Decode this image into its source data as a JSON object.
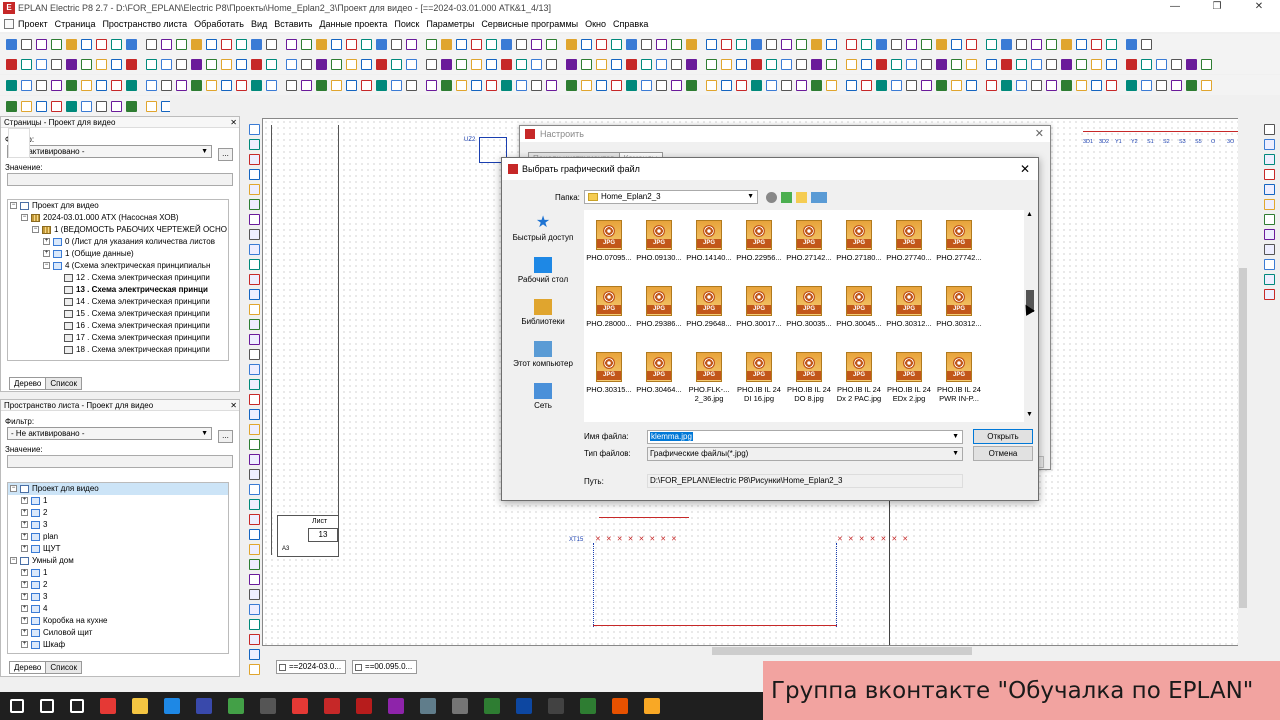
{
  "window": {
    "title": "EPLAN Electric P8 2.7 - D:\\FOR_EPLAN\\Electric P8\\Проекты\\Home_Eplan2_3\\Проект для видео - [==2024-03.01.000 АТК&1_4/13]",
    "app_icon": "eplan-icon"
  },
  "menu": [
    "Проект",
    "Страница",
    "Пространство листа",
    "Обработать",
    "Вид",
    "Вставить",
    "Данные проекта",
    "Поиск",
    "Параметры",
    "Сервисные программы",
    "Окно",
    "Справка"
  ],
  "toolbar_row1_extra": "9  ∅",
  "pages_pane": {
    "title": "Страницы - Проект для видео",
    "filter_label": "Фильтр:",
    "filter_value": "- Не активировано -",
    "value_label": "Значение:",
    "dots": "...",
    "tree": [
      {
        "text": "Проект для видео",
        "level": 0,
        "pm": "−",
        "icon": "doc"
      },
      {
        "text": "2024-03.01.000 АТХ (Насосная ХОВ)",
        "level": 1,
        "pm": "−",
        "icon": "grid"
      },
      {
        "text": "1 (ВЕДОМОСТЬ РАБОЧИХ ЧЕРТЕЖЕЙ ОСНО",
        "level": 2,
        "pm": "−",
        "icon": "grid"
      },
      {
        "text": "0 (Лист для указания количества листов",
        "level": 3,
        "pm": "+",
        "icon": "page"
      },
      {
        "text": "1 (Общие данные)",
        "level": 3,
        "pm": "+",
        "icon": "page"
      },
      {
        "text": "4 (Схема электрическая  принципиальн",
        "level": 3,
        "pm": "−",
        "icon": "page"
      },
      {
        "text": "12 . Схема электрическая принципи",
        "level": 4,
        "pm": "",
        "icon": "sheet"
      },
      {
        "text": "13 . Схема электрическая принци",
        "level": 4,
        "pm": "",
        "icon": "sheet",
        "bold": true
      },
      {
        "text": "14 . Схема электрическая принципи",
        "level": 4,
        "pm": "",
        "icon": "sheet"
      },
      {
        "text": "15 . Схема электрическая принципи",
        "level": 4,
        "pm": "",
        "icon": "sheet"
      },
      {
        "text": "16 . Схема электрическая принципи",
        "level": 4,
        "pm": "",
        "icon": "sheet"
      },
      {
        "text": "17 . Схема электрическая принципи",
        "level": 4,
        "pm": "",
        "icon": "sheet"
      },
      {
        "text": "18 . Схема электрическая принципи",
        "level": 4,
        "pm": "",
        "icon": "sheet"
      }
    ],
    "tabs": [
      "Дерево",
      "Список"
    ]
  },
  "layout_pane": {
    "title": "Пространство листа - Проект для видео",
    "filter_label": "Фильтр:",
    "filter_value": "- Не активировано -",
    "value_label": "Значение:",
    "dots": "...",
    "tree": [
      {
        "text": "Проект для видео",
        "level": 0,
        "pm": "−",
        "icon": "doc",
        "selected": true
      },
      {
        "text": "1",
        "level": 1,
        "pm": "+",
        "icon": "page"
      },
      {
        "text": "2",
        "level": 1,
        "pm": "+",
        "icon": "page"
      },
      {
        "text": "3",
        "level": 1,
        "pm": "+",
        "icon": "page"
      },
      {
        "text": "plan",
        "level": 1,
        "pm": "+",
        "icon": "page"
      },
      {
        "text": "ЩУТ",
        "level": 1,
        "pm": "+",
        "icon": "page"
      },
      {
        "text": "Умный дом",
        "level": 0,
        "pm": "−",
        "icon": "doc"
      },
      {
        "text": "1",
        "level": 1,
        "pm": "+",
        "icon": "page"
      },
      {
        "text": "2",
        "level": 1,
        "pm": "+",
        "icon": "page"
      },
      {
        "text": "3",
        "level": 1,
        "pm": "+",
        "icon": "page"
      },
      {
        "text": "4",
        "level": 1,
        "pm": "+",
        "icon": "page"
      },
      {
        "text": "Коробка на кухне",
        "level": 1,
        "pm": "+",
        "icon": "page"
      },
      {
        "text": "Силовой щит",
        "level": 1,
        "pm": "+",
        "icon": "page"
      },
      {
        "text": "Шкаф",
        "level": 1,
        "pm": "+",
        "icon": "page"
      }
    ],
    "tabs": [
      "Дерево",
      "Список"
    ]
  },
  "canvas": {
    "label_uz2": "UZ2",
    "label_xt15": "XT15",
    "sheet_label": "Лист",
    "sheet_num": "13",
    "format": "А3",
    "header_labels": [
      "3D1",
      "3D2",
      "Y1",
      "Y2",
      "S1",
      "S2",
      "S3",
      "S5",
      "O",
      "3O"
    ]
  },
  "settings_dialog": {
    "title": "Настроить",
    "tabs": [
      "Панели инструментов",
      "Команды"
    ]
  },
  "file_dialog": {
    "title": "Выбрать графический файл",
    "folder_label": "Папка:",
    "folder_value": "Home_Eplan2_3",
    "places": [
      {
        "label": "Быстрый доступ",
        "icon": "star-icon",
        "color": "#1e73d2"
      },
      {
        "label": "Рабочий стол",
        "icon": "desktop-icon",
        "color": "#1e88e5"
      },
      {
        "label": "Библиотеки",
        "icon": "library-icon",
        "color": "#e0a52e"
      },
      {
        "label": "Этот компьютер",
        "icon": "computer-icon",
        "color": "#5a9bd5"
      },
      {
        "label": "Сеть",
        "icon": "network-icon",
        "color": "#4a90d9"
      }
    ],
    "files": [
      [
        "PHO.07095...",
        "PHO.09130...",
        "PHO.14140...",
        "PHO.22956...",
        "PHO.27142...",
        "PHO.27180...",
        "PHO.27740...",
        "PHO.27742..."
      ],
      [
        "PHO.28000...",
        "PHO.29386...",
        "PHO.29648...",
        "PHO.30017...",
        "PHO.30035...",
        "PHO.30045...",
        "PHO.30312...",
        "PHO.30312..."
      ],
      [
        "PHO.30315...",
        "PHO.30464...",
        "PHO.FLK-...\n2_36.jpg",
        "PHO.IB IL 24\nDI 16.jpg",
        "PHO.IB IL 24\nDO 8.jpg",
        "PHO.IB IL 24\nDx 2 PAC.jpg",
        "PHO.IB IL 24\nEDx 2.jpg",
        "PHO.IB IL 24\nPWR IN-P..."
      ]
    ],
    "jpg_badge": "JPG",
    "filename_label": "Имя файла:",
    "filename_value": "klemma.jpg",
    "filetype_label": "Тип файлов:",
    "filetype_value": "Графические файлы(*.jpg)",
    "path_label": "Путь:",
    "path_value": "D:\\FOR_EPLAN\\Electric P8\\Рисунки\\Home_Eplan2_3",
    "open_button": "Открыть",
    "cancel_button": "Отмена"
  },
  "doc_tabs": [
    "==2024-03.0...",
    "==00.095.0..."
  ],
  "banner_text": "Группа вконтакте \"Обучалка по EPLAN\"",
  "taskbar_icons": [
    {
      "name": "windows-start-icon",
      "color": "#ffffff"
    },
    {
      "name": "search-icon",
      "color": "#ffffff"
    },
    {
      "name": "task-view-icon",
      "color": "#ffffff"
    },
    {
      "name": "app-c-icon",
      "color": "#e53935"
    },
    {
      "name": "explorer-icon",
      "color": "#f4c542"
    },
    {
      "name": "edge-icon",
      "color": "#1e88e5"
    },
    {
      "name": "app-blue-icon",
      "color": "#3949ab"
    },
    {
      "name": "chrome-icon",
      "color": "#43a047"
    },
    {
      "name": "app-dark-icon",
      "color": "#555555"
    },
    {
      "name": "opera-icon",
      "color": "#e53935"
    },
    {
      "name": "eplan-icon",
      "color": "#c62828"
    },
    {
      "name": "eplan2-icon",
      "color": "#b71c1c"
    },
    {
      "name": "app-g-icon",
      "color": "#8e24aa"
    },
    {
      "name": "app-gray-icon",
      "color": "#607d8b"
    },
    {
      "name": "pdf-icon",
      "color": "#757575"
    },
    {
      "name": "app-3-icon",
      "color": "#2e7d32"
    },
    {
      "name": "photoshop-icon",
      "color": "#0d47a1"
    },
    {
      "name": "app-dark2-icon",
      "color": "#424242"
    },
    {
      "name": "app-ds-icon",
      "color": "#2e7d32"
    },
    {
      "name": "app-g2-icon",
      "color": "#e65100"
    },
    {
      "name": "app-box-icon",
      "color": "#f9a825"
    }
  ]
}
